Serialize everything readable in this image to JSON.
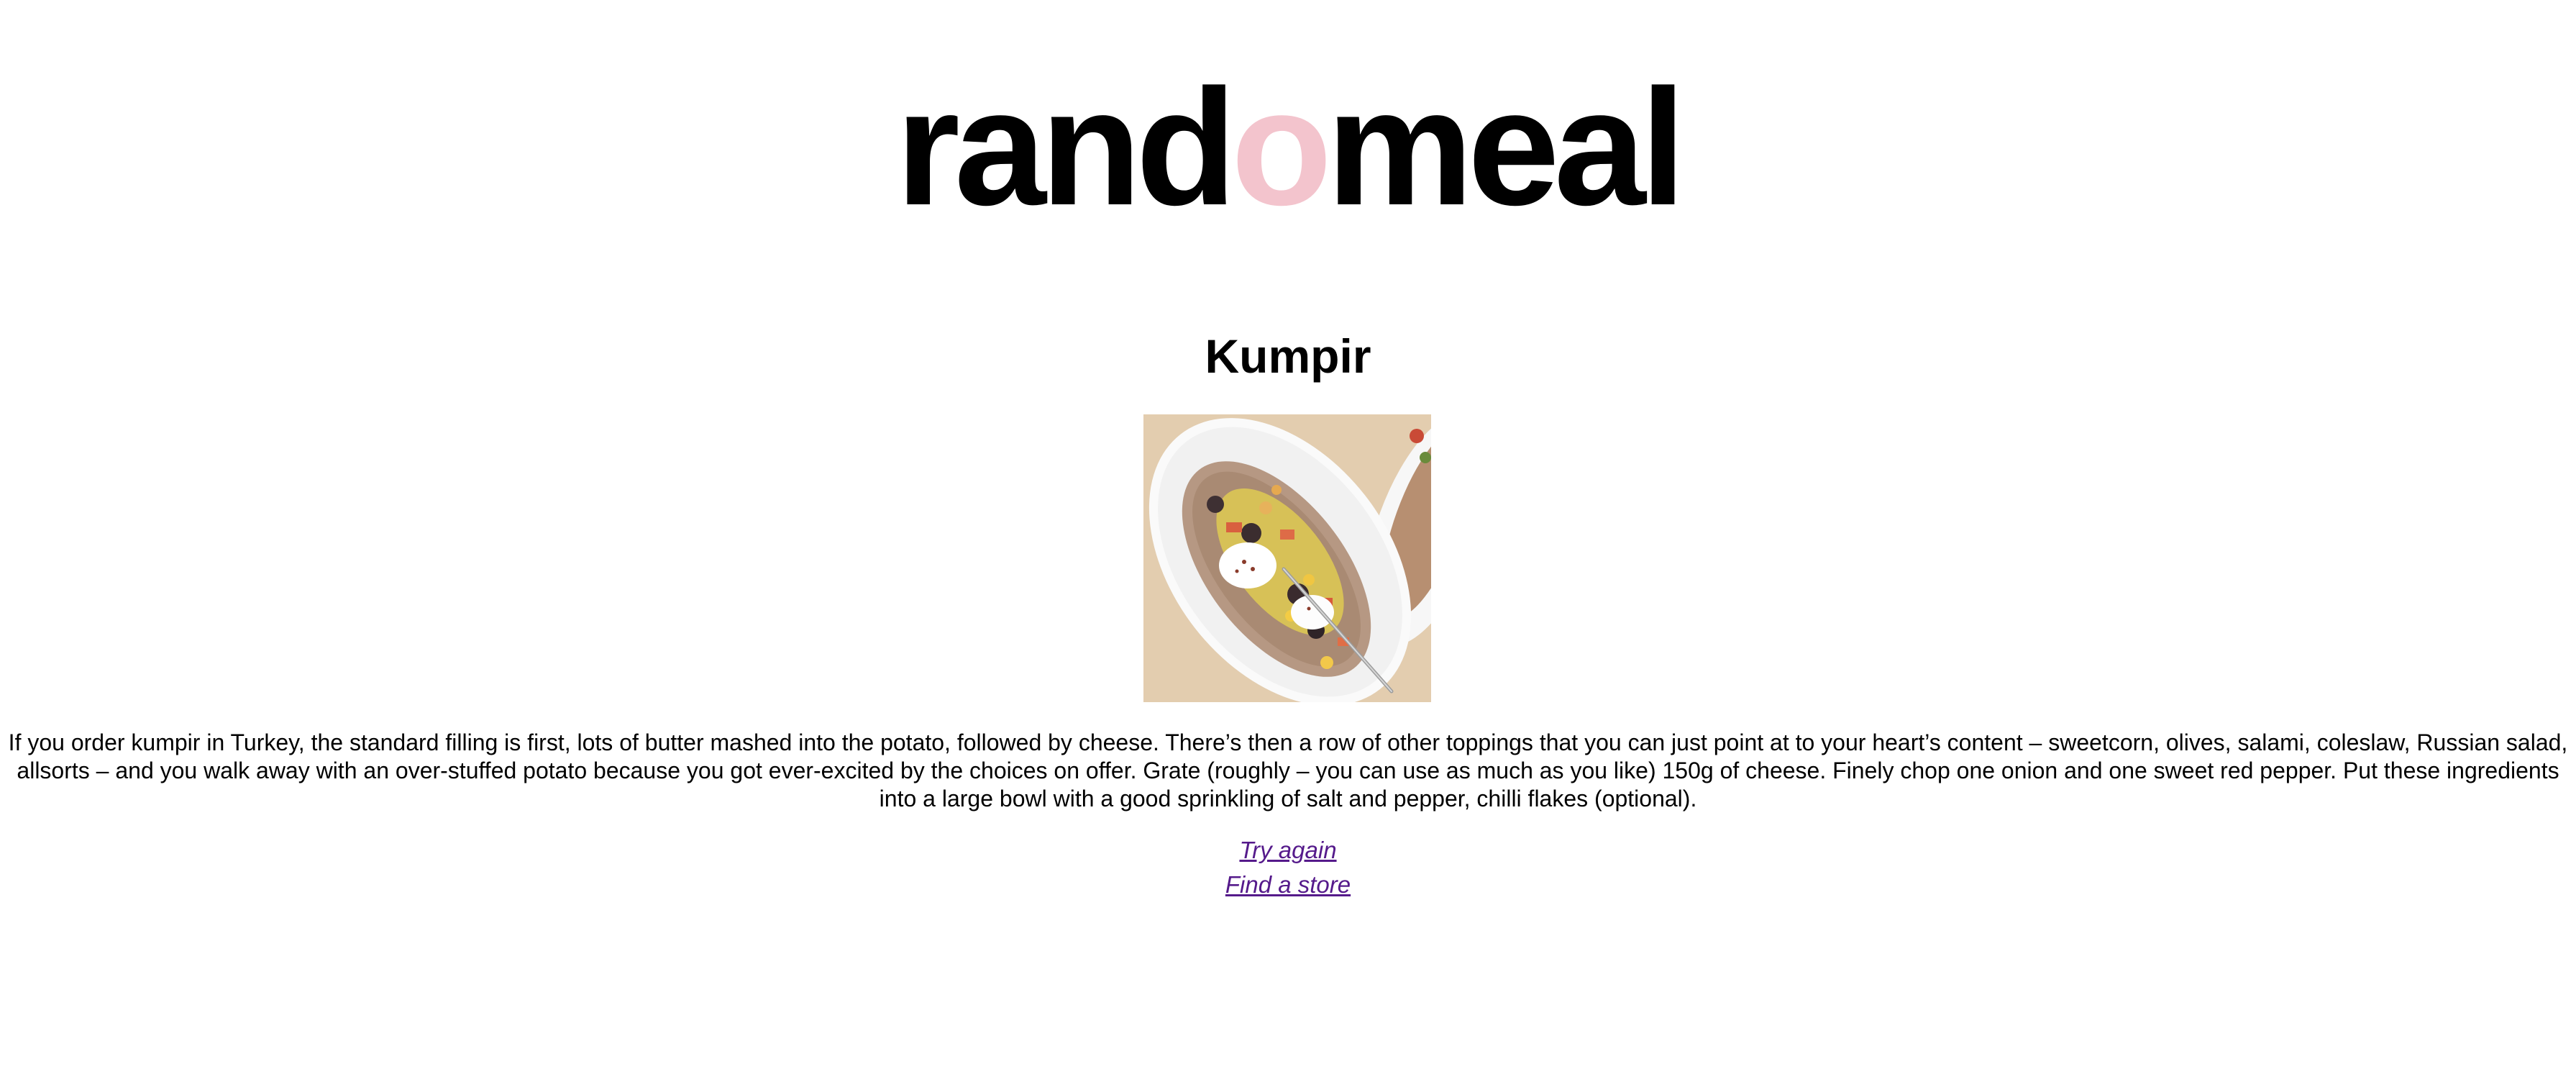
{
  "logo": {
    "part1": "rand",
    "accent": "o",
    "part2": "meal"
  },
  "meal": {
    "title": "Kumpir",
    "image_alt": "Kumpir",
    "description": "If you order kumpir in Turkey, the standard filling is first, lots of butter mashed into the potato, followed by cheese. There’s then a row of other toppings that you can just point at to your heart’s content – sweetcorn, olives, salami, coleslaw, Russian salad, allsorts – and you walk away with an over-stuffed potato because you got ever-excited by the choices on offer. Grate (roughly – you can use as much as you like) 150g of cheese. Finely chop one onion and one sweet red pepper. Put these ingredients into a large bowl with a good sprinkling of salt and pepper, chilli flakes (optional)."
  },
  "links": {
    "try_again": "Try again",
    "find_store": "Find a store"
  },
  "colors": {
    "accent": "#f3c4cd",
    "link": "#551a8b",
    "text": "#000000",
    "background": "#ffffff"
  }
}
